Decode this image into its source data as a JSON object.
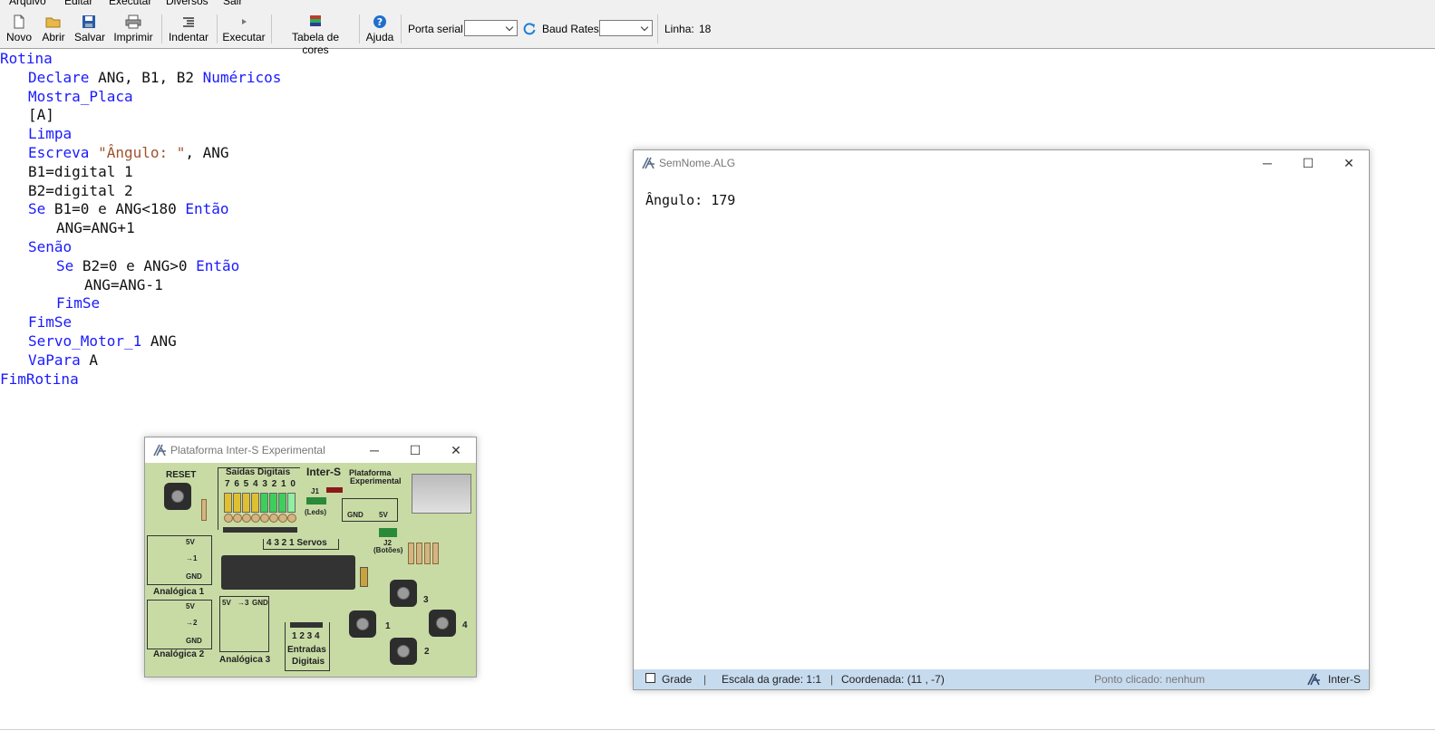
{
  "menu": [
    "Arquivo",
    "Editar",
    "Executar",
    "Diversos",
    "Sair"
  ],
  "toolbar": {
    "novo": "Novo",
    "abrir": "Abrir",
    "salvar": "Salvar",
    "imprimir": "Imprimir",
    "indentar": "Indentar",
    "executar": "Executar",
    "tabela": "Tabela de cores",
    "ajuda": "Ajuda",
    "porta_serial": "Porta serial",
    "porta_value": "",
    "baud_rates": "Baud Rates",
    "baud_value": "",
    "linha_label": "Linha:",
    "linha_value": "18"
  },
  "code": [
    {
      "indent": 0,
      "parts": [
        {
          "t": "Rotina",
          "c": "kw"
        }
      ]
    },
    {
      "indent": 1,
      "parts": [
        {
          "t": "Declare",
          "c": "kw"
        },
        {
          "t": " ANG, B1, B2 ",
          "c": "tx"
        },
        {
          "t": "Numéricos",
          "c": "kw"
        }
      ]
    },
    {
      "indent": 1,
      "parts": [
        {
          "t": "Mostra_Placa",
          "c": "kw"
        }
      ]
    },
    {
      "indent": 1,
      "parts": [
        {
          "t": "[A]",
          "c": "tx"
        }
      ]
    },
    {
      "indent": 1,
      "parts": [
        {
          "t": "Limpa",
          "c": "kw"
        }
      ]
    },
    {
      "indent": 1,
      "parts": [
        {
          "t": "Escreva ",
          "c": "kw"
        },
        {
          "t": "\"Ângulo: \"",
          "c": "str"
        },
        {
          "t": ", ANG",
          "c": "tx"
        }
      ]
    },
    {
      "indent": 1,
      "parts": [
        {
          "t": "B1=digital 1",
          "c": "tx"
        }
      ]
    },
    {
      "indent": 1,
      "parts": [
        {
          "t": "B2=digital 2",
          "c": "tx"
        }
      ]
    },
    {
      "indent": 1,
      "parts": [
        {
          "t": "Se",
          "c": "kw"
        },
        {
          "t": " B1=0 e ANG<180 ",
          "c": "tx"
        },
        {
          "t": "Então",
          "c": "kw"
        }
      ]
    },
    {
      "indent": 2,
      "parts": [
        {
          "t": "ANG=ANG+1",
          "c": "tx"
        }
      ]
    },
    {
      "indent": 1,
      "parts": [
        {
          "t": "Senão",
          "c": "kw"
        }
      ]
    },
    {
      "indent": 2,
      "parts": [
        {
          "t": "Se",
          "c": "kw"
        },
        {
          "t": " B2=0 e ANG>0 ",
          "c": "tx"
        },
        {
          "t": "Então",
          "c": "kw"
        }
      ]
    },
    {
      "indent": 3,
      "parts": [
        {
          "t": "ANG=ANG-1",
          "c": "tx"
        }
      ]
    },
    {
      "indent": 2,
      "parts": [
        {
          "t": "FimSe",
          "c": "kw"
        }
      ]
    },
    {
      "indent": 1,
      "parts": [
        {
          "t": "FimSe",
          "c": "kw"
        }
      ]
    },
    {
      "indent": 1,
      "parts": [
        {
          "t": "Servo_Motor_1",
          "c": "kw"
        },
        {
          "t": " ANG",
          "c": "tx"
        }
      ]
    },
    {
      "indent": 1,
      "parts": [
        {
          "t": "VaPara",
          "c": "kw"
        },
        {
          "t": " A",
          "c": "tx"
        }
      ]
    },
    {
      "indent": 0,
      "parts": [
        {
          "t": "FimRotina",
          "c": "kw"
        }
      ]
    }
  ],
  "output_window": {
    "title": "SemNome.ALG",
    "output_text": "Ângulo: 179",
    "status": {
      "grade": "Grade",
      "escala": "Escala da grade: 1:1",
      "coordenada": "Coordenada: (11 , -7)",
      "ponto": "Ponto clicado: nenhum",
      "brand": "Inter-S"
    }
  },
  "board_window": {
    "title": "Plataforma Inter-S Experimental",
    "labels": {
      "reset": "RESET",
      "saidas": "Saídas Digitais",
      "saidas_nums": "7 6 5 4 3 2 1 0",
      "brand": "Inter-S",
      "plataforma": "Plataforma",
      "experimental": "Experimental",
      "j1": "J1",
      "leds": "(Leds)",
      "gnd": "GND",
      "v5": "5V",
      "servos": "4 3 2 1  Servos",
      "j2": "J2",
      "botoes": "(Botões)",
      "an1": "Analógica 1",
      "an2": "Analógica 2",
      "an3": "Analógica 3",
      "pot_5v": "5V",
      "pot_1": "→1",
      "pot_2": "→2",
      "pot_3": "→3",
      "pot_gnd": "GND",
      "entradas_nums": "1 2 3 4",
      "entradas": "Entradas",
      "digitais": "Digitais",
      "b1": "1",
      "b2": "2",
      "b3": "3",
      "b4": "4"
    }
  }
}
